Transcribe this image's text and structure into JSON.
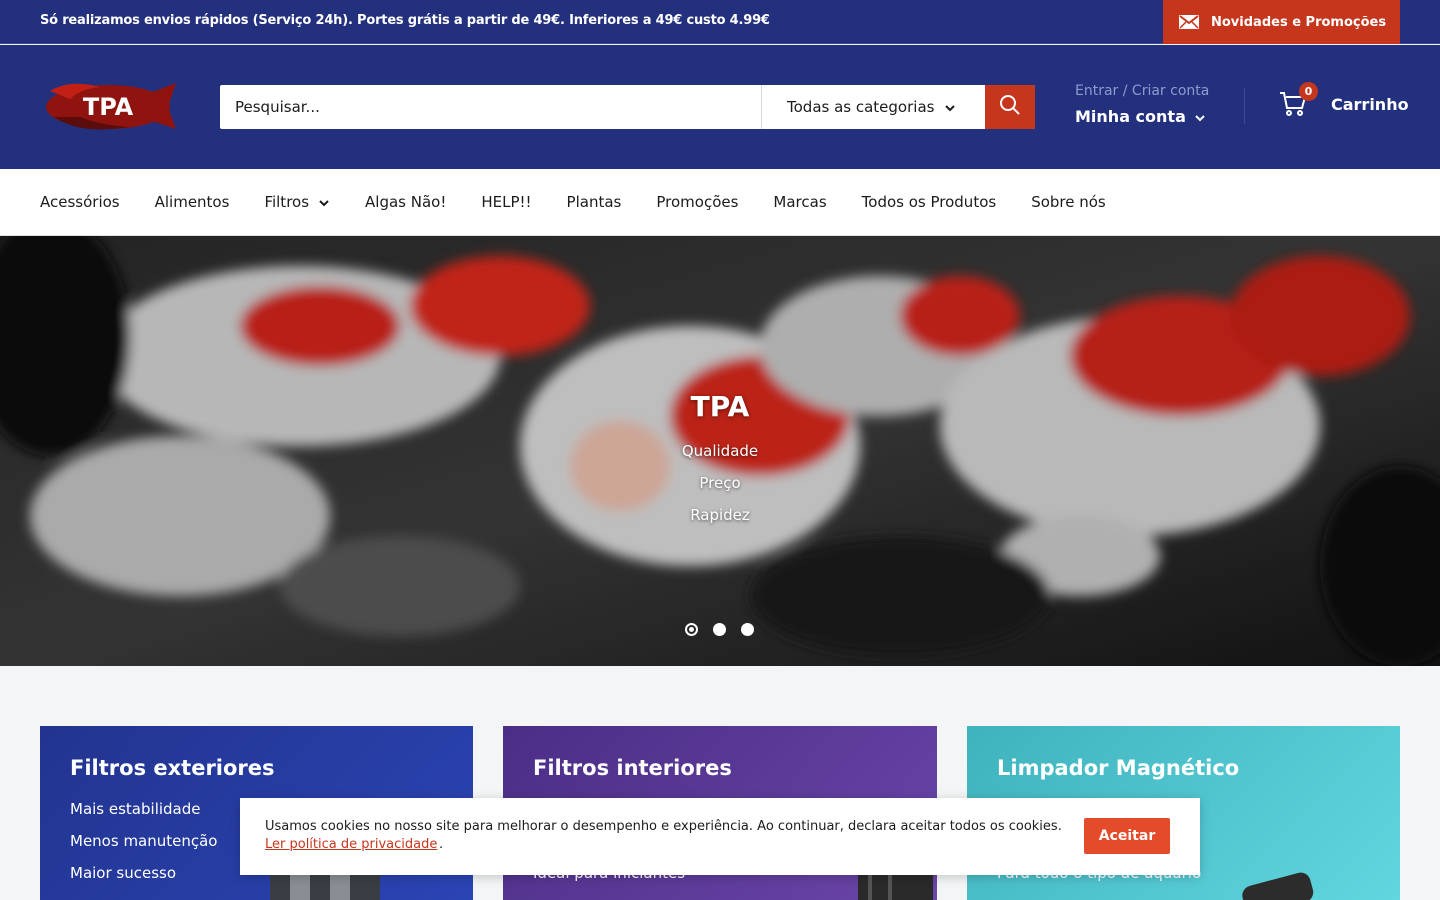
{
  "announcement": {
    "text": "Só realizamos envios rápidos (Serviço 24h). Portes grátis a partir de 49€. Inferiores a 49€ custo 4.99€",
    "promo_label": "Novidades e Promoções"
  },
  "header": {
    "logo_text": "TPA",
    "search_placeholder": "Pesquisar...",
    "category_selected": "Todas as categorias",
    "account_small": "Entrar / Criar conta",
    "account_main": "Minha conta",
    "cart_count": "0",
    "cart_label": "Carrinho"
  },
  "nav": {
    "items": [
      "Acessórios",
      "Alimentos",
      "Filtros",
      "Algas Não!",
      "HELP!!",
      "Plantas",
      "Promoções",
      "Marcas",
      "Todos os Produtos",
      "Sobre nós"
    ]
  },
  "hero": {
    "title": "TPA",
    "lines": [
      "Qualidade",
      "Preço",
      "Rapidez"
    ],
    "slide_count": 3,
    "active_slide": 1
  },
  "cards": [
    {
      "title": "Filtros exteriores",
      "features": [
        "Mais estabilidade",
        "Menos manutenção",
        "Maior sucesso"
      ]
    },
    {
      "title": "Filtros interiores",
      "features": [
        "Ideal para iniciantes"
      ]
    },
    {
      "title": "Limpador Magnético",
      "features": [
        "Para todo o tipo de aquário"
      ]
    }
  ],
  "cookie": {
    "text": "Usamos cookies no nosso site para melhorar o desempenho e experiência. Ao continuar, declara aceitar todos os cookies.",
    "link": "Ler política de privacidade",
    "period": ".",
    "button": "Aceitar"
  },
  "colors": {
    "primary": "#23307e",
    "accent": "#c5361d",
    "accept": "#e44b2b"
  }
}
